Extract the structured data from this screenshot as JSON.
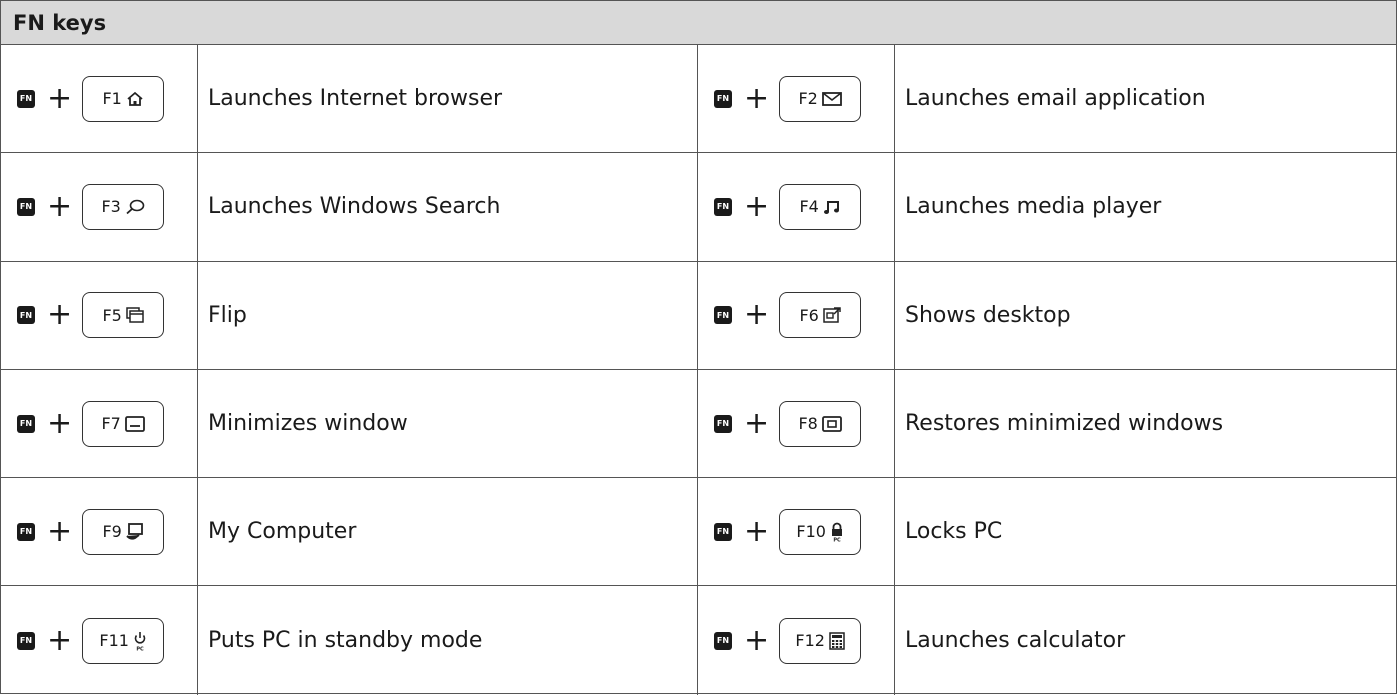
{
  "header": {
    "title": "FN keys"
  },
  "fn_label": "FN",
  "plus": "+",
  "rows": [
    {
      "left": {
        "key": "F1",
        "icon": "home-icon",
        "desc": "Launches Internet browser"
      },
      "right": {
        "key": "F2",
        "icon": "mail-icon",
        "desc": "Launches email application"
      }
    },
    {
      "left": {
        "key": "F3",
        "icon": "search-icon",
        "desc": "Launches Windows Search"
      },
      "right": {
        "key": "F4",
        "icon": "music-note-icon",
        "desc": "Launches media player"
      }
    },
    {
      "left": {
        "key": "F5",
        "icon": "flip-windows-icon",
        "desc": "Flip"
      },
      "right": {
        "key": "F6",
        "icon": "show-desktop-icon",
        "desc": "Shows desktop"
      }
    },
    {
      "left": {
        "key": "F7",
        "icon": "minimize-window-icon",
        "desc": "Minimizes window"
      },
      "right": {
        "key": "F8",
        "icon": "restore-window-icon",
        "desc": "Restores minimized windows"
      }
    },
    {
      "left": {
        "key": "F9",
        "icon": "my-computer-icon",
        "desc": "My Computer"
      },
      "right": {
        "key": "F10",
        "icon": "lock-pc-icon",
        "desc": "Locks PC"
      }
    },
    {
      "left": {
        "key": "F11",
        "icon": "standby-pc-icon",
        "desc": "Puts PC in standby mode"
      },
      "right": {
        "key": "F12",
        "icon": "calculator-icon",
        "desc": "Launches calculator"
      }
    }
  ]
}
